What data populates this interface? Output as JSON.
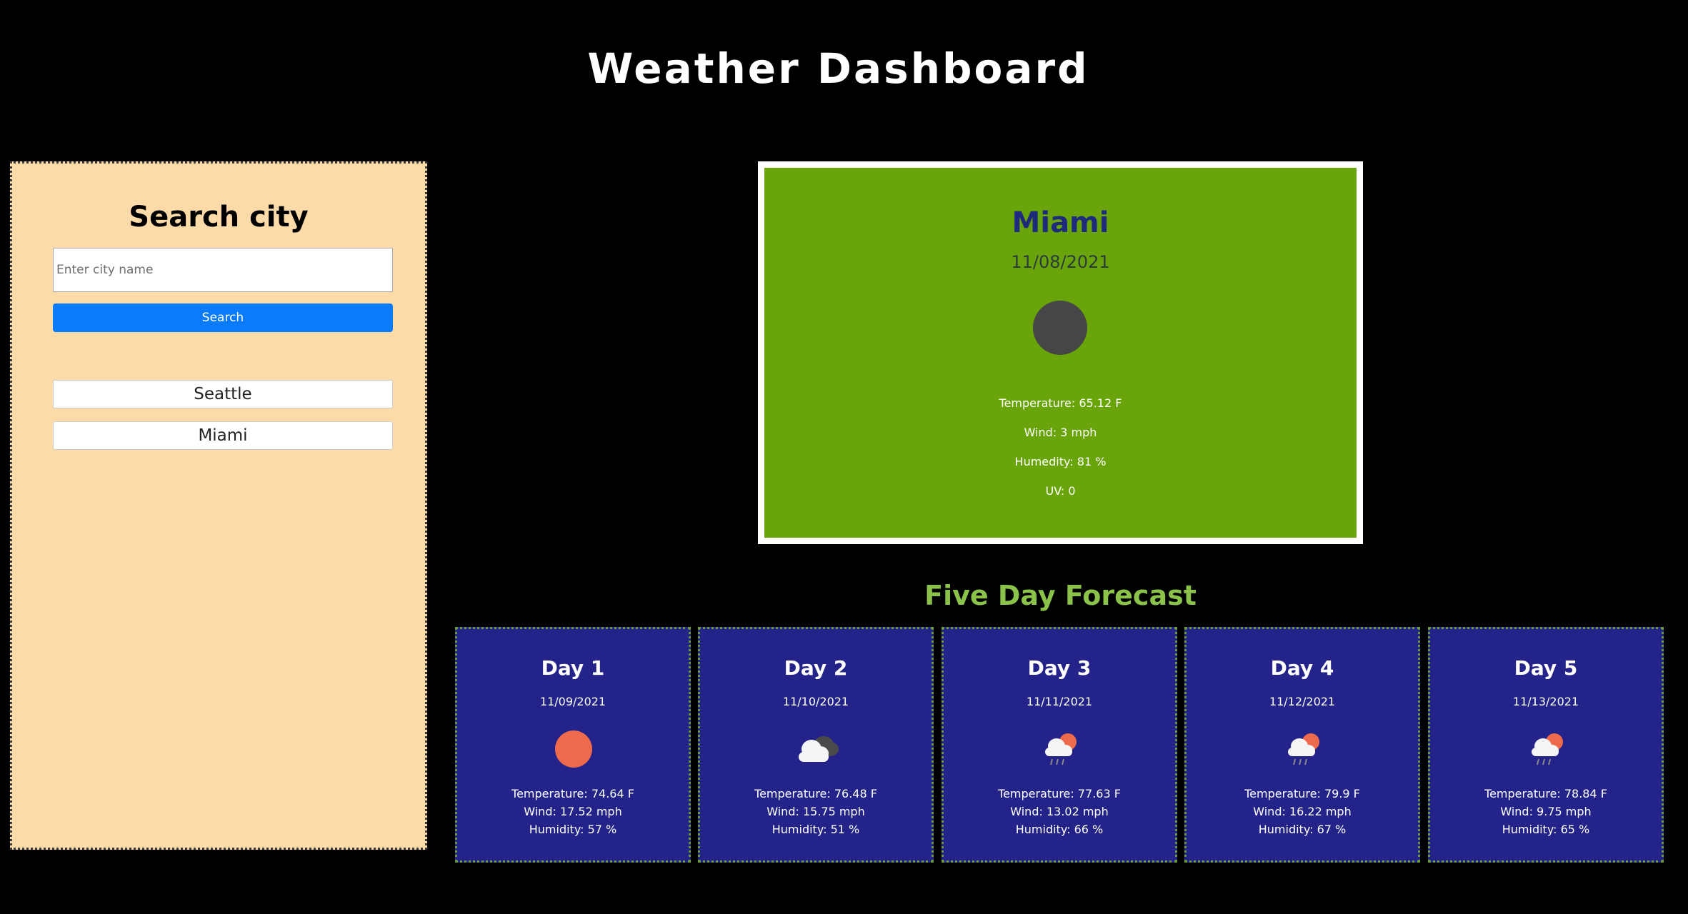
{
  "app": {
    "title": "Weather Dashboard"
  },
  "search": {
    "title": "Search city",
    "placeholder": "Enter city name",
    "value": "",
    "button_label": "Search",
    "history": [
      "Seattle",
      "Miami"
    ]
  },
  "current": {
    "city": "Miami",
    "date": "11/08/2021",
    "icon": "dark-circle-icon",
    "temperature": "Temperature: 65.12 F",
    "wind": "Wind: 3 mph",
    "humidity": "Humedity: 81 %",
    "uv": "UV: 0"
  },
  "forecast": {
    "title": "Five Day Forecast",
    "days": [
      {
        "label": "Day 1",
        "date": "11/09/2021",
        "icon": "sun-icon",
        "temperature": "Temperature: 74.64 F",
        "wind": "Wind: 17.52 mph",
        "humidity": "Humidity: 57 %"
      },
      {
        "label": "Day 2",
        "date": "11/10/2021",
        "icon": "clouds-icon",
        "temperature": "Temperature: 76.48 F",
        "wind": "Wind: 15.75 mph",
        "humidity": "Humidity: 51 %"
      },
      {
        "label": "Day 3",
        "date": "11/11/2021",
        "icon": "rain-sun-icon",
        "temperature": "Temperature: 77.63 F",
        "wind": "Wind: 13.02 mph",
        "humidity": "Humidity: 66 %"
      },
      {
        "label": "Day 4",
        "date": "11/12/2021",
        "icon": "rain-sun-icon",
        "temperature": "Temperature: 79.9 F",
        "wind": "Wind: 16.22 mph",
        "humidity": "Humidity: 67 %"
      },
      {
        "label": "Day 5",
        "date": "11/13/2021",
        "icon": "rain-sun-icon",
        "temperature": "Temperature: 78.84 F",
        "wind": "Wind: 9.75 mph",
        "humidity": "Humidity: 65 %"
      }
    ]
  },
  "colors": {
    "background": "#000000",
    "search_panel": "#fddba8",
    "current_card": "#69a50a",
    "forecast_card": "#232389",
    "forecast_title": "#8bc34a",
    "search_button": "#0b7cf9",
    "city_name": "#1e2a7c"
  }
}
